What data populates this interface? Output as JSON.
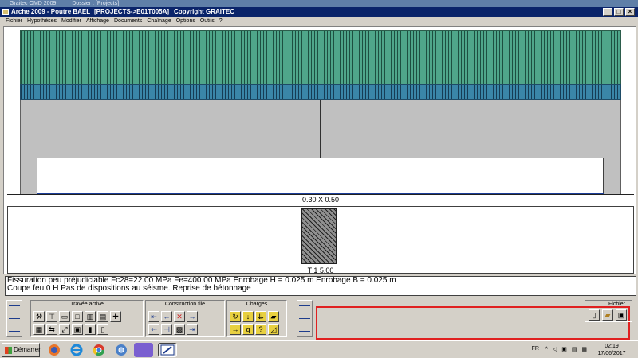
{
  "outer_title": {
    "app": "Graitec OMD 2009",
    "folder": "Dossier : [Projects]"
  },
  "window": {
    "app_name": "Arche 2009 - Poutre BAEL",
    "project": "[PROJECTS->E01T005A]",
    "copyright": "Copyright GRAITEC",
    "controls": [
      "_",
      "□",
      "×"
    ]
  },
  "menu": [
    "Fichier",
    "Hypothèses",
    "Modifier",
    "Affichage",
    "Documents",
    "Chaînage",
    "Options",
    "Outils",
    "?"
  ],
  "drawing": {
    "beam_section_label": "0.30 X 0.50",
    "span_label": "T 1  5.00"
  },
  "info": {
    "line1": "Fissuration peu préjudiciable  Fc28=22.00 MPa  Fe=400.00 MPa   Enrobage H = 0.025 m   Enrobage B = 0.025 m",
    "line2": "Coupe feu 0 H        Pas de dispositions au séisme.  Reprise de bétonnage"
  },
  "toolbar": {
    "travee_title": "Travée active",
    "construction_title": "Construction file",
    "charges_title": "Charges",
    "fichier_title": "Fichier",
    "travee_tools": [
      "hammer-icon",
      "t-beam-icon",
      "frame-icon",
      "square-icon",
      "chart-icon",
      "grid-icon",
      "plus-icon",
      "grid-small-icon",
      "section-icon",
      "arrows-icon",
      "expand-icon",
      "bar-icon",
      "book-icon"
    ],
    "construction_tools": [
      "arrow-left-beam-icon",
      "arrow-left-support-icon",
      "cross-span-icon",
      "arrow-right-icon",
      "arrow-right-beam-icon",
      "dashed-left-icon",
      "insert-icon",
      "stack-icon"
    ],
    "charges_tools": [
      "moment-load-icon",
      "point-load-icon",
      "uniform-load-icon",
      "partial-load-icon",
      "trapezoid-load-icon",
      "arrow-load-icon",
      "q-load-icon",
      "help-load-icon"
    ],
    "file_tools": [
      "new-file-icon",
      "open-folder-icon",
      "save-icon"
    ]
  },
  "taskbar": {
    "start_label": "Démarrer",
    "apps": [
      "firefox-icon",
      "ie-icon",
      "chrome-icon",
      "chromium-icon",
      "arche-app-icon",
      "arche-active-icon"
    ],
    "language": "FR",
    "tray_icons": "^ ◁ ▣ ▤ ▦",
    "time": "02:19",
    "date": "17/06/2017"
  },
  "colors": {
    "slab": "#4fa68a",
    "band": "#3a86a8",
    "beam_base": "#1b3d98",
    "title_bar": "#0a246a",
    "highlight": "#e02020"
  }
}
